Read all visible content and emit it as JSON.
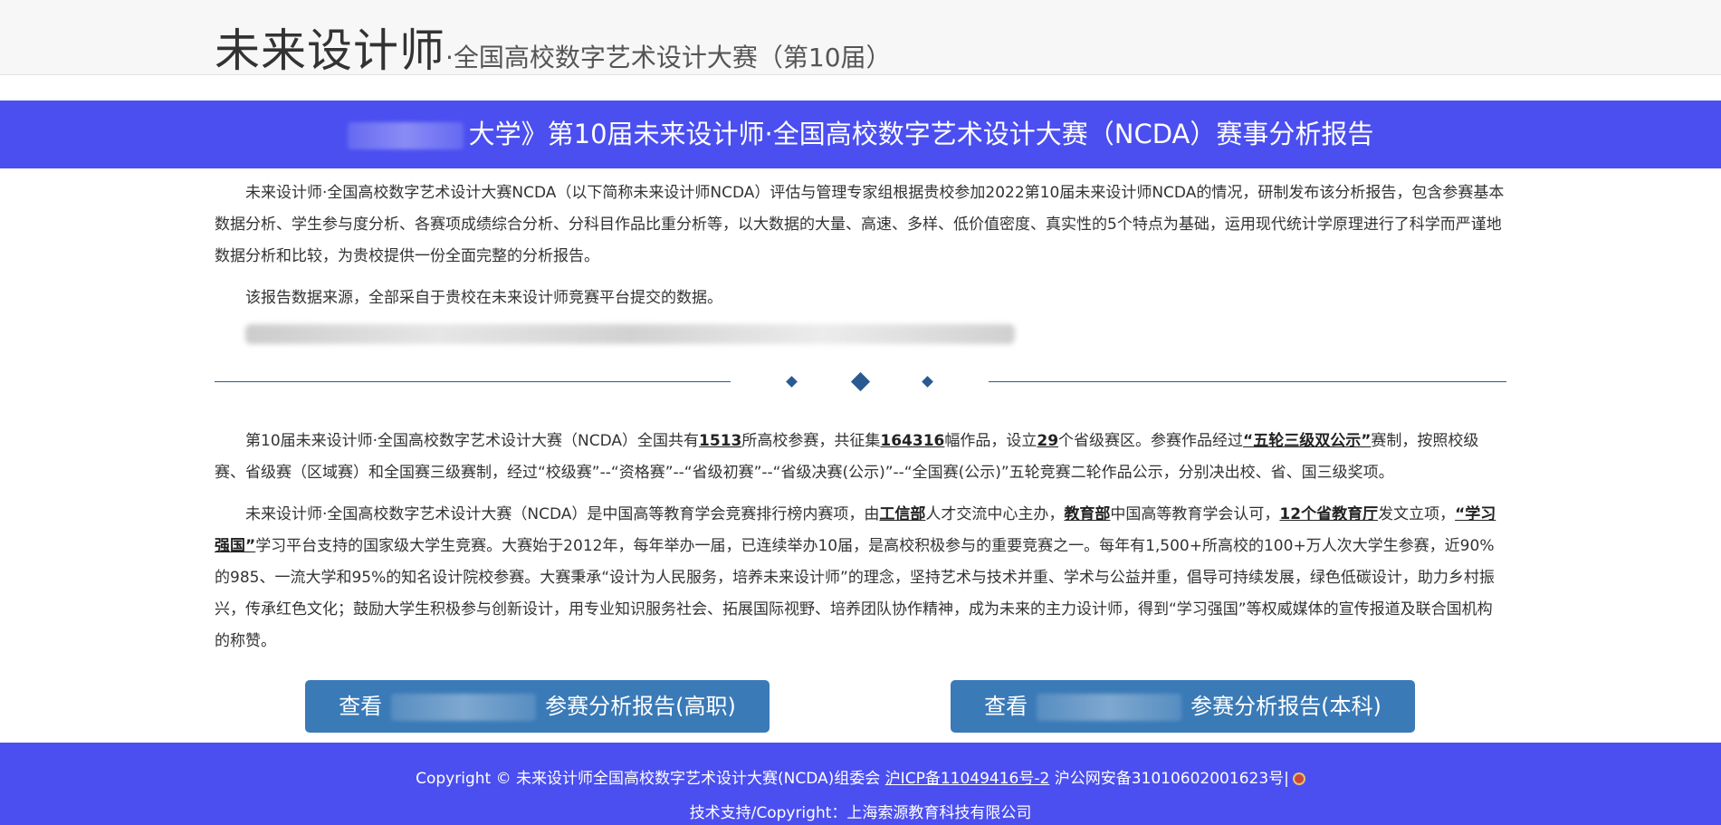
{
  "header": {
    "logo": "未来设计师",
    "dot": "·",
    "subtitle": "全国高校数字艺术设计大赛（第10届）"
  },
  "banner": {
    "title": "大学》第10届未来设计师·全国高校数字艺术设计大赛（NCDA）赛事分析报告"
  },
  "intro": {
    "p1": "未来设计师·全国高校数字艺术设计大赛NCDA（以下简称未来设计师NCDA）评估与管理专家组根据贵校参加2022第10届未来设计师NCDA的情况，研制发布该分析报告，包含参赛基本数据分析、学生参与度分析、各赛项成绩综合分析、分科目作品比重分析等，以大数据的大量、高速、多样、低价值密度、真实性的5个特点为基础，运用现代统计学原理进行了科学而严谨地数据分析和比较，为贵校提供一份全面完整的分析报告。",
    "p2": "该报告数据来源，全部采自于贵校在未来设计师竞赛平台提交的数据。"
  },
  "stats": {
    "s1": "第10届未来设计师·全国高校数字艺术设计大赛（NCDA）全国共有",
    "schools": "1513",
    "s2": "所高校参赛，共征集",
    "works": "164316",
    "s3": "幅作品，设立",
    "regions": "29",
    "s4": "个省级赛区。参赛作品经过",
    "system": "“五轮三级双公示”",
    "s5": "赛制，按照校级赛、省级赛（区域赛）和全国赛三级赛制，经过“校级赛”--“资格赛”--“省级初赛”--“省级决赛(公示)”--“全国赛(公示)”五轮竞赛二轮作品公示，分别决出校、省、国三级奖项。"
  },
  "about": {
    "a1": "未来设计师·全国高校数字艺术设计大赛（NCDA）是中国高等教育学会竞赛排行榜内赛项，由",
    "miit": "工信部",
    "a2": "人才交流中心主办，",
    "moe": "教育部",
    "a3": "中国高等教育学会认可，",
    "provinces": "12个省教育厅",
    "a4": "发文立项，",
    "xuexi": "“学习强国”",
    "a5": "学习平台支持的国家级大学生竞赛。大赛始于2012年，每年举办一届，已连续举办10届，是高校积极参与的重要竞赛之一。每年有1,500+所高校的100+万人次大学生参赛，近90%的985、一流大学和95%的知名设计院校参赛。大赛秉承“设计为人民服务，培养未来设计师”的理念，坚持艺术与技术并重、学术与公益并重，倡导可持续发展，绿色低碳设计，助力乡村振兴，传承红色文化；鼓励大学生积极参与创新设计，用专业知识服务社会、拓展国际视野、培养团队协作精神，成为未来的主力设计师，得到“学习强国”等权威媒体的宣传报道及联合国机构的称赞。"
  },
  "buttons": {
    "view": "查看",
    "vocational": "参赛分析报告(高职)",
    "undergrad": "参赛分析报告(本科)"
  },
  "footer": {
    "copyright": "Copyright © 未来设计师全国高校数字艺术设计大赛(NCDA)组委会",
    "icp": "沪ICP备11049416号-2",
    "police": "沪公网安备31010602001623号|",
    "support": "技术支持/Copyright：上海索源教育科技有限公司"
  },
  "colors": {
    "banner_bg": "#4b4ff0",
    "button_bg": "#3a7ab7",
    "divider": "#2a5a92"
  }
}
